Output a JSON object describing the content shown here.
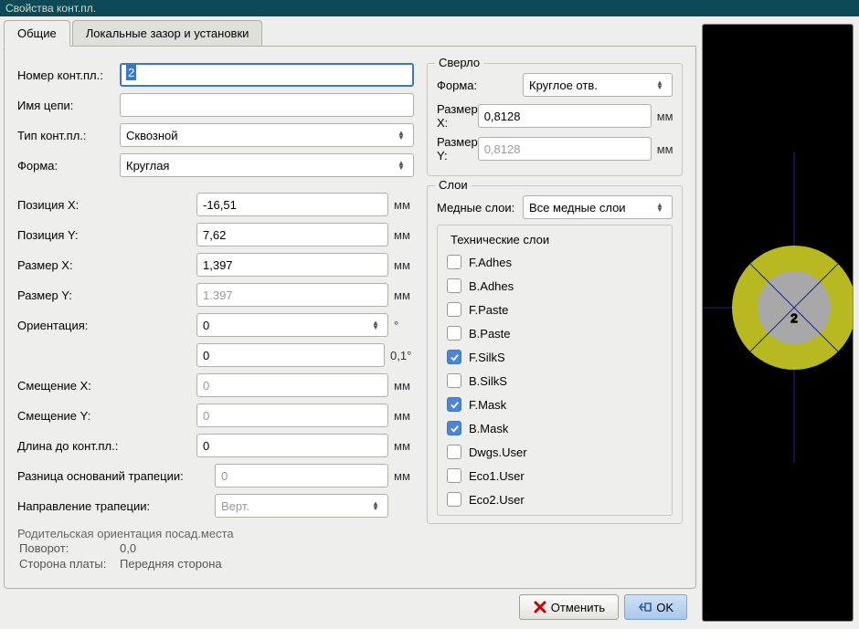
{
  "window_title": "Свойства конт.пл.",
  "tabs": {
    "general": "Общие",
    "local": "Локальные зазор и установки"
  },
  "left": {
    "pad_number_label": "Номер конт.пл.:",
    "pad_number": "2",
    "net_name_label": "Имя цепи:",
    "net_name": "",
    "pad_type_label": "Тип конт.пл.:",
    "pad_type": "Сквозной",
    "shape_label": "Форма:",
    "shape": "Круглая",
    "posx_label": "Позиция X:",
    "posx": "-16,51",
    "posy_label": "Позиция Y:",
    "posy": "7,62",
    "sizex_label": "Размер X:",
    "sizex": "1,397",
    "sizey_label": "Размер Y:",
    "sizey": "1.397",
    "orient_label": "Ориентация:",
    "orient": "0",
    "orient_fine": "0",
    "offx_label": "Смещение X:",
    "offx": "0",
    "offy_label": "Смещение Y:",
    "offy": "0",
    "padlen_label": "Длина до конт.пл.:",
    "padlen": "0",
    "trapdelta_label": "Разница оснований трапеции:",
    "trapdelta": "0",
    "trapdir_label": "Направление трапеции:",
    "trapdir": "Верт.",
    "parent_title": "Родительская ориентация посад.места",
    "parent_rot_k": "Поворот:",
    "parent_rot_v": "0,0",
    "parent_side_k": "Сторона платы:",
    "parent_side_v": "Передняя сторона"
  },
  "units": {
    "mm": "мм",
    "deg": "°",
    "tenth": "0,1°"
  },
  "drill": {
    "legend": "Сверло",
    "shape_label": "Форма:",
    "shape": "Круглое отв.",
    "sizex_label": "Размер X:",
    "sizex": "0,8128",
    "sizey_label": "Размер Y:",
    "sizey": "0,8128"
  },
  "layers": {
    "legend": "Слои",
    "copper_label": "Медные слои:",
    "copper": "Все медные слои",
    "tech_legend": "Технические слои",
    "items": [
      {
        "label": "F.Adhes",
        "checked": false
      },
      {
        "label": "B.Adhes",
        "checked": false
      },
      {
        "label": "F.Paste",
        "checked": false
      },
      {
        "label": "B.Paste",
        "checked": false
      },
      {
        "label": "F.SilkS",
        "checked": true
      },
      {
        "label": "B.SilkS",
        "checked": false
      },
      {
        "label": "F.Mask",
        "checked": true
      },
      {
        "label": "B.Mask",
        "checked": true
      },
      {
        "label": "Dwgs.User",
        "checked": false
      },
      {
        "label": "Eco1.User",
        "checked": false
      },
      {
        "label": "Eco2.User",
        "checked": false
      }
    ]
  },
  "preview_text": "2",
  "buttons": {
    "cancel": "Отменить",
    "ok": "OK"
  }
}
